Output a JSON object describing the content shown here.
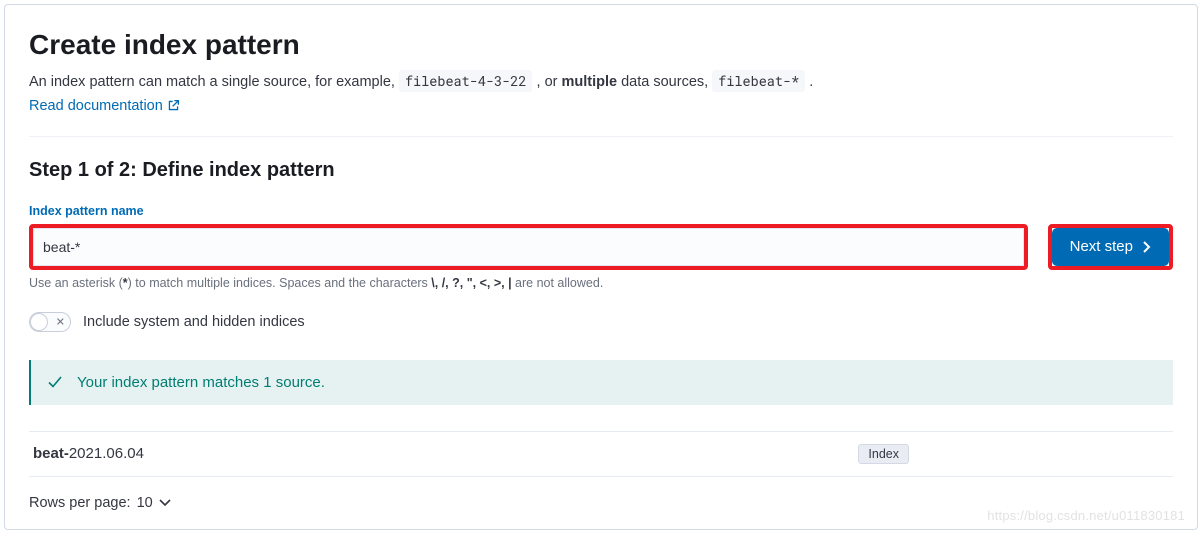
{
  "header": {
    "title": "Create index pattern",
    "desc_prefix": "An index pattern can match a single source, for example, ",
    "desc_code1": "filebeat-4-3-22",
    "desc_mid": " , or ",
    "desc_bold": "multiple",
    "desc_after_bold": " data sources, ",
    "desc_code2": "filebeat-*",
    "desc_suffix": " .",
    "doc_link_label": "Read documentation"
  },
  "step": {
    "title": "Step 1 of 2: Define index pattern",
    "field_label": "Index pattern name",
    "input_value": "beat-*",
    "next_button_label": "Next step",
    "help_prefix": "Use an asterisk (",
    "help_star": "*",
    "help_mid": ") to match multiple indices. Spaces and the characters ",
    "help_chars": "\\, /, ?, \", <, >, |",
    "help_suffix": " are not allowed.",
    "toggle_label": "Include system and hidden indices",
    "toggle_on": false
  },
  "callout": {
    "text": "Your index pattern matches 1 source."
  },
  "table": {
    "rows": [
      {
        "name_bold": "beat-",
        "name_rest": "2021.06.04",
        "badge": "Index"
      }
    ]
  },
  "pager": {
    "label_prefix": "Rows per page: ",
    "value": "10"
  },
  "watermark": "https://blog.csdn.net/u011830181"
}
